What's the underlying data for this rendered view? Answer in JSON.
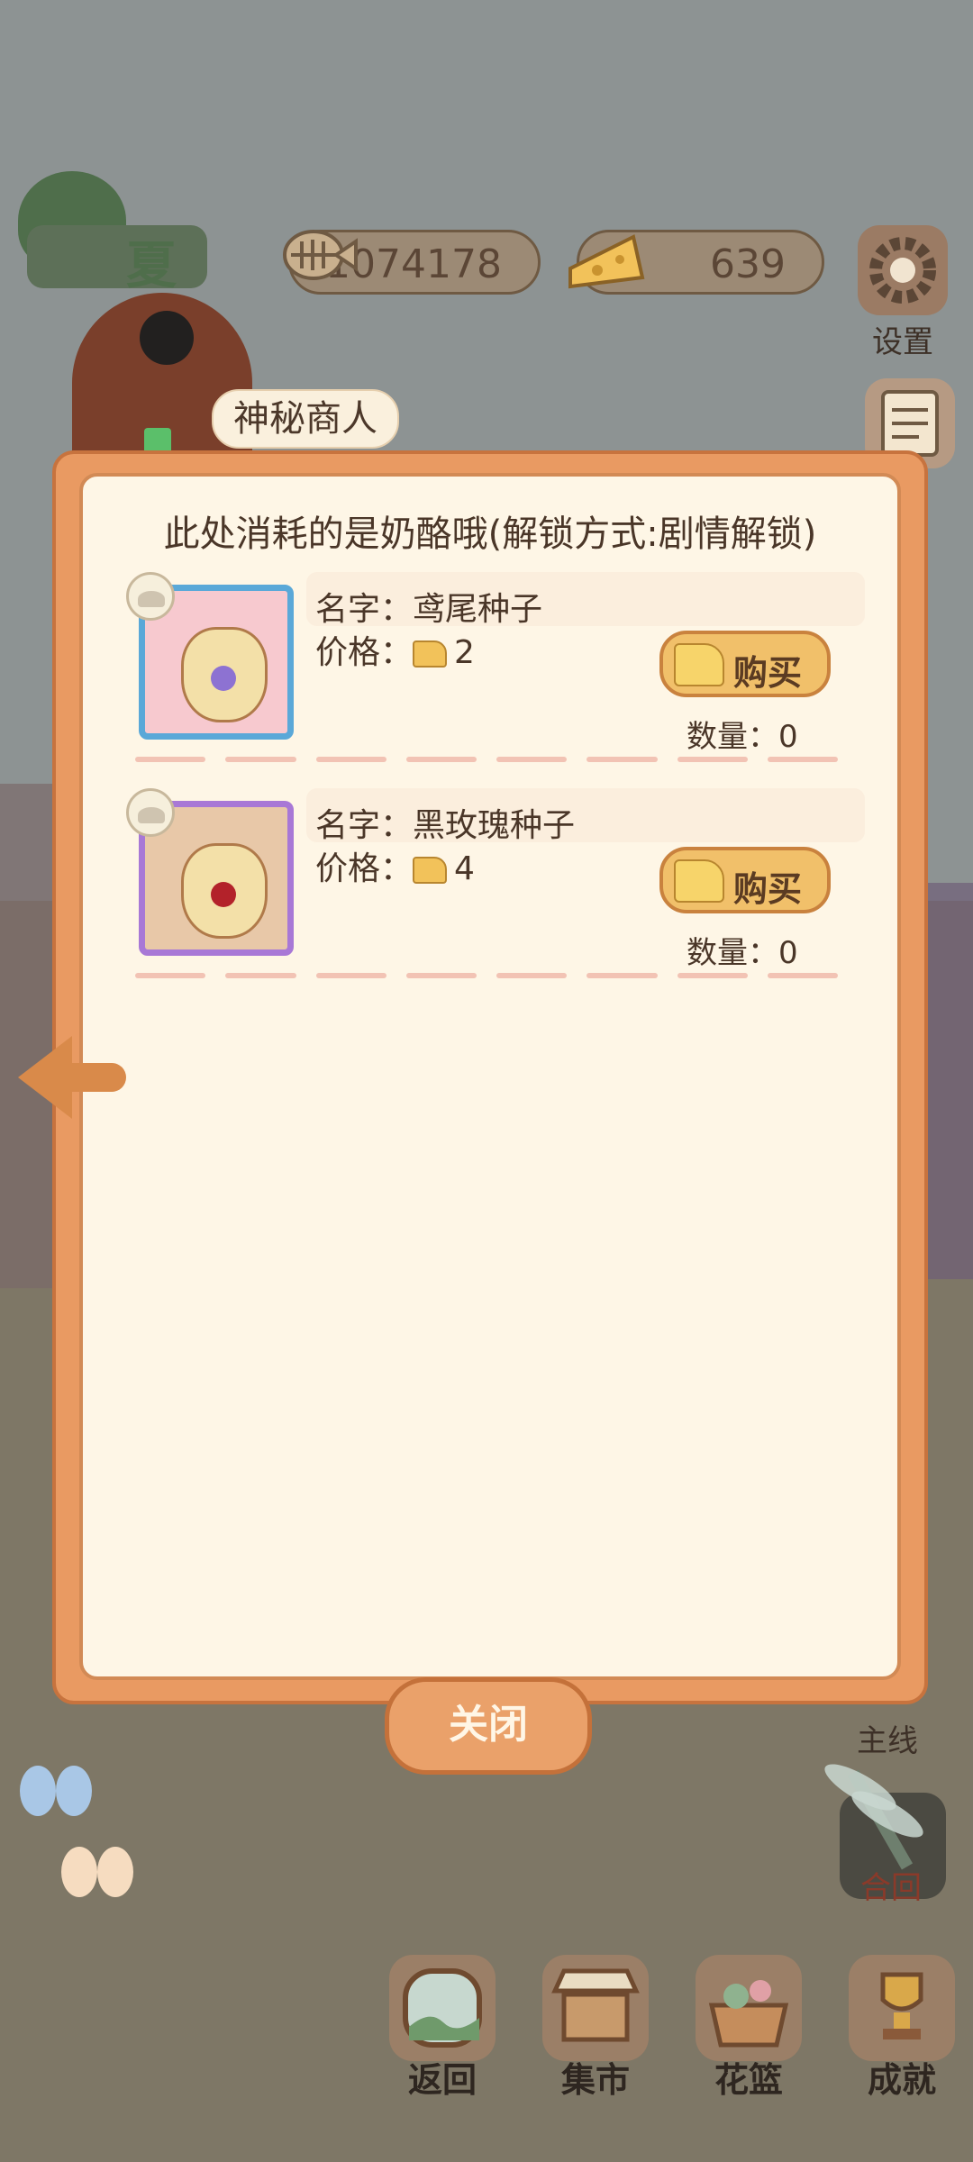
{
  "season": {
    "label": "夏"
  },
  "resources": {
    "fish_bones": "1074178",
    "cheese": "639"
  },
  "side_menu": {
    "settings_label": "设置",
    "main_quest_label": "主线",
    "collection_label": "合回"
  },
  "merchant": {
    "name": "神秘商人"
  },
  "shop": {
    "title": "此处消耗的是奶酪哦(解锁方式:剧情解锁)",
    "items": [
      {
        "name_label": "名字：",
        "name": "鸢尾种子",
        "price_label": "价格：",
        "price": "2",
        "buy_label": "购买",
        "qty_label": "数量：",
        "qty": "0"
      },
      {
        "name_label": "名字：",
        "name": "黑玫瑰种子",
        "price_label": "价格：",
        "price": "4",
        "buy_label": "购买",
        "qty_label": "数量：",
        "qty": "0"
      }
    ],
    "close_label": "关闭"
  },
  "bottom_nav": [
    {
      "label": "返回",
      "icon": "window-icon"
    },
    {
      "label": "集市",
      "icon": "market-stall-icon"
    },
    {
      "label": "花篮",
      "icon": "flower-basket-icon"
    },
    {
      "label": "成就",
      "icon": "trophy-icon"
    }
  ],
  "colors": {
    "panel_bg": "#fef6e6",
    "panel_border": "#e99a62",
    "buy_button": "#f1c06a",
    "close_button": "#eaa16a"
  }
}
